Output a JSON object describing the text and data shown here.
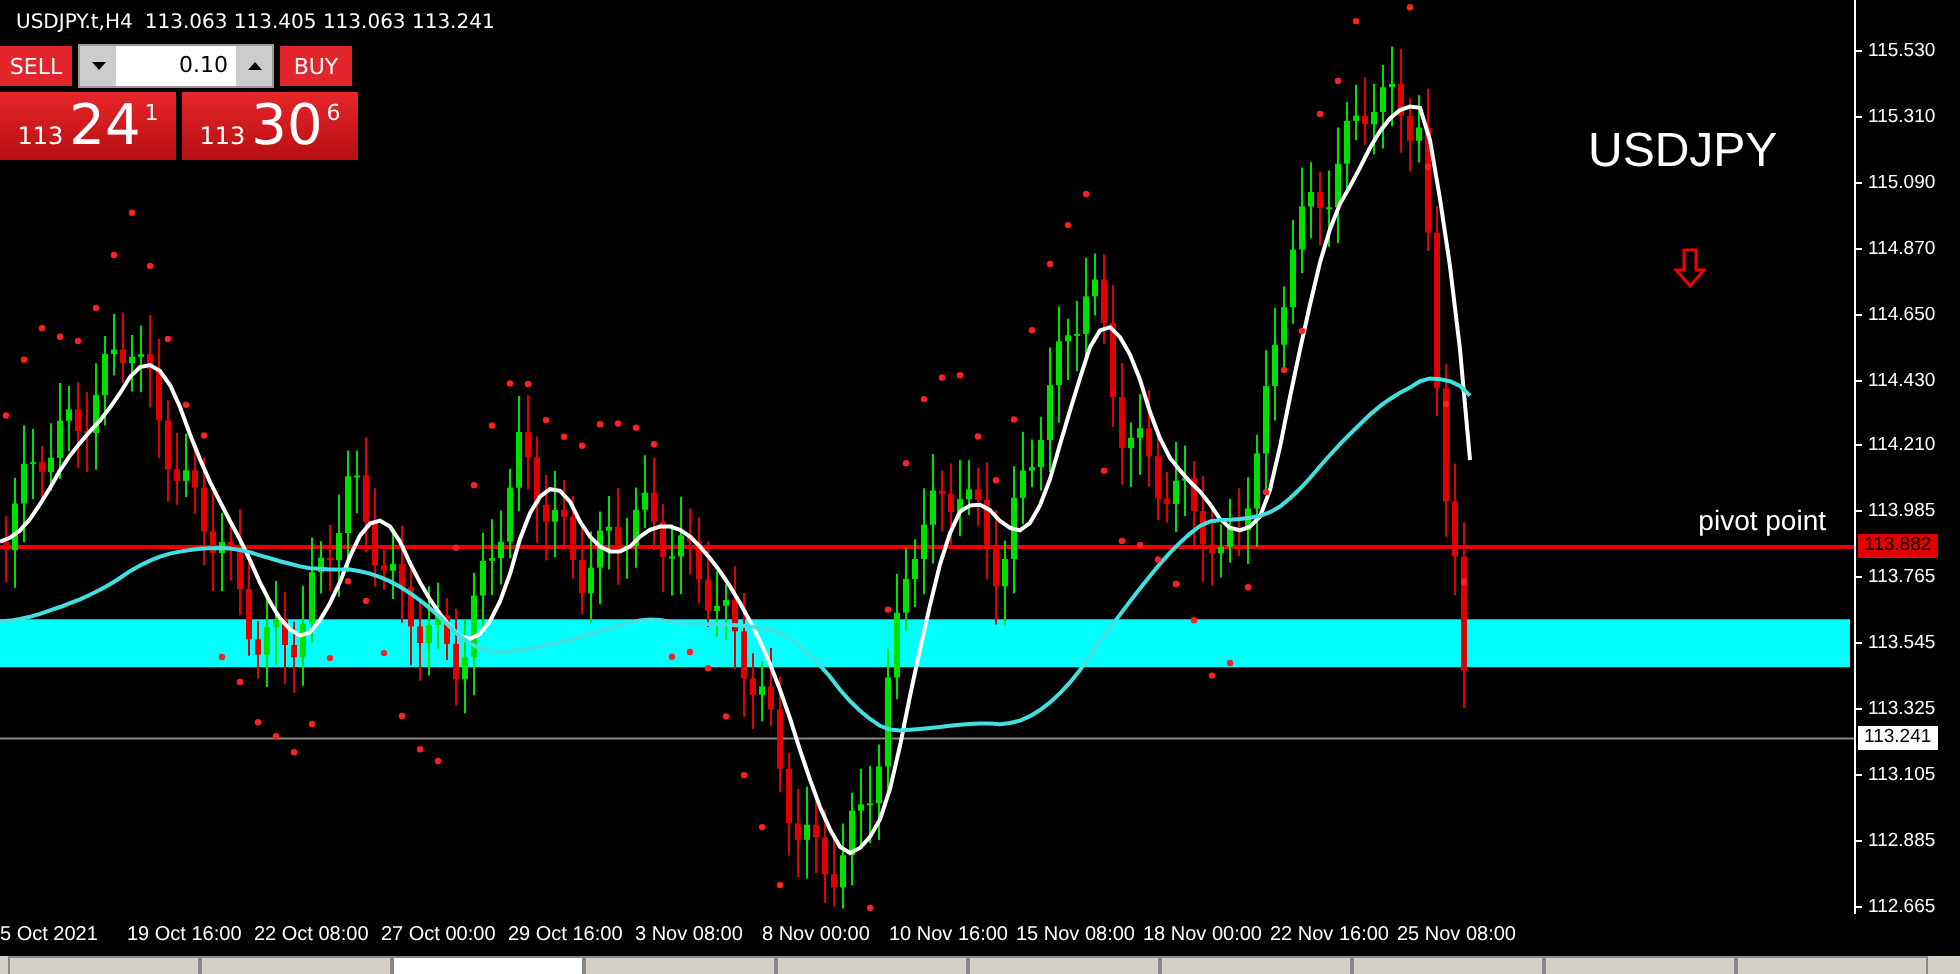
{
  "chart_header": {
    "symbol": "USDJPY.t,H4",
    "ohlc": "113.063 113.405 113.063 113.241"
  },
  "trade_panel": {
    "sell_label": "SELL",
    "buy_label": "BUY",
    "lot": "0.10",
    "sell_price": {
      "prefix": "113",
      "main": "24",
      "suffix": "1"
    },
    "buy_price": {
      "prefix": "113",
      "main": "30",
      "suffix": "6"
    }
  },
  "chart_labels": {
    "title": "USDJPY",
    "line_label": "pivot point"
  },
  "price_axis": {
    "ticks": [
      "115.530",
      "115.310",
      "115.090",
      "114.870",
      "114.650",
      "114.430",
      "114.210",
      "113.985",
      "113.765",
      "113.545",
      "113.325",
      "113.105",
      "112.885",
      "112.665"
    ],
    "pivot_tag": "113.882",
    "current_tag": "113.241"
  },
  "time_axis": [
    "5 Oct 2021",
    "19 Oct 16:00",
    "22 Oct 08:00",
    "27 Oct 00:00",
    "29 Oct 16:00",
    "3 Nov 08:00",
    "8 Nov 00:00",
    "10 Nov 16:00",
    "15 Nov 08:00",
    "18 Nov 00:00",
    "22 Nov 16:00",
    "25 Nov 08:00"
  ],
  "bottom_tabs": [
    {
      "selected": false
    },
    {
      "selected": false
    },
    {
      "selected": true
    },
    {
      "selected": false
    },
    {
      "selected": false
    },
    {
      "selected": false
    },
    {
      "selected": false
    },
    {
      "selected": false
    },
    {
      "selected": false
    },
    {
      "selected": false
    }
  ]
}
